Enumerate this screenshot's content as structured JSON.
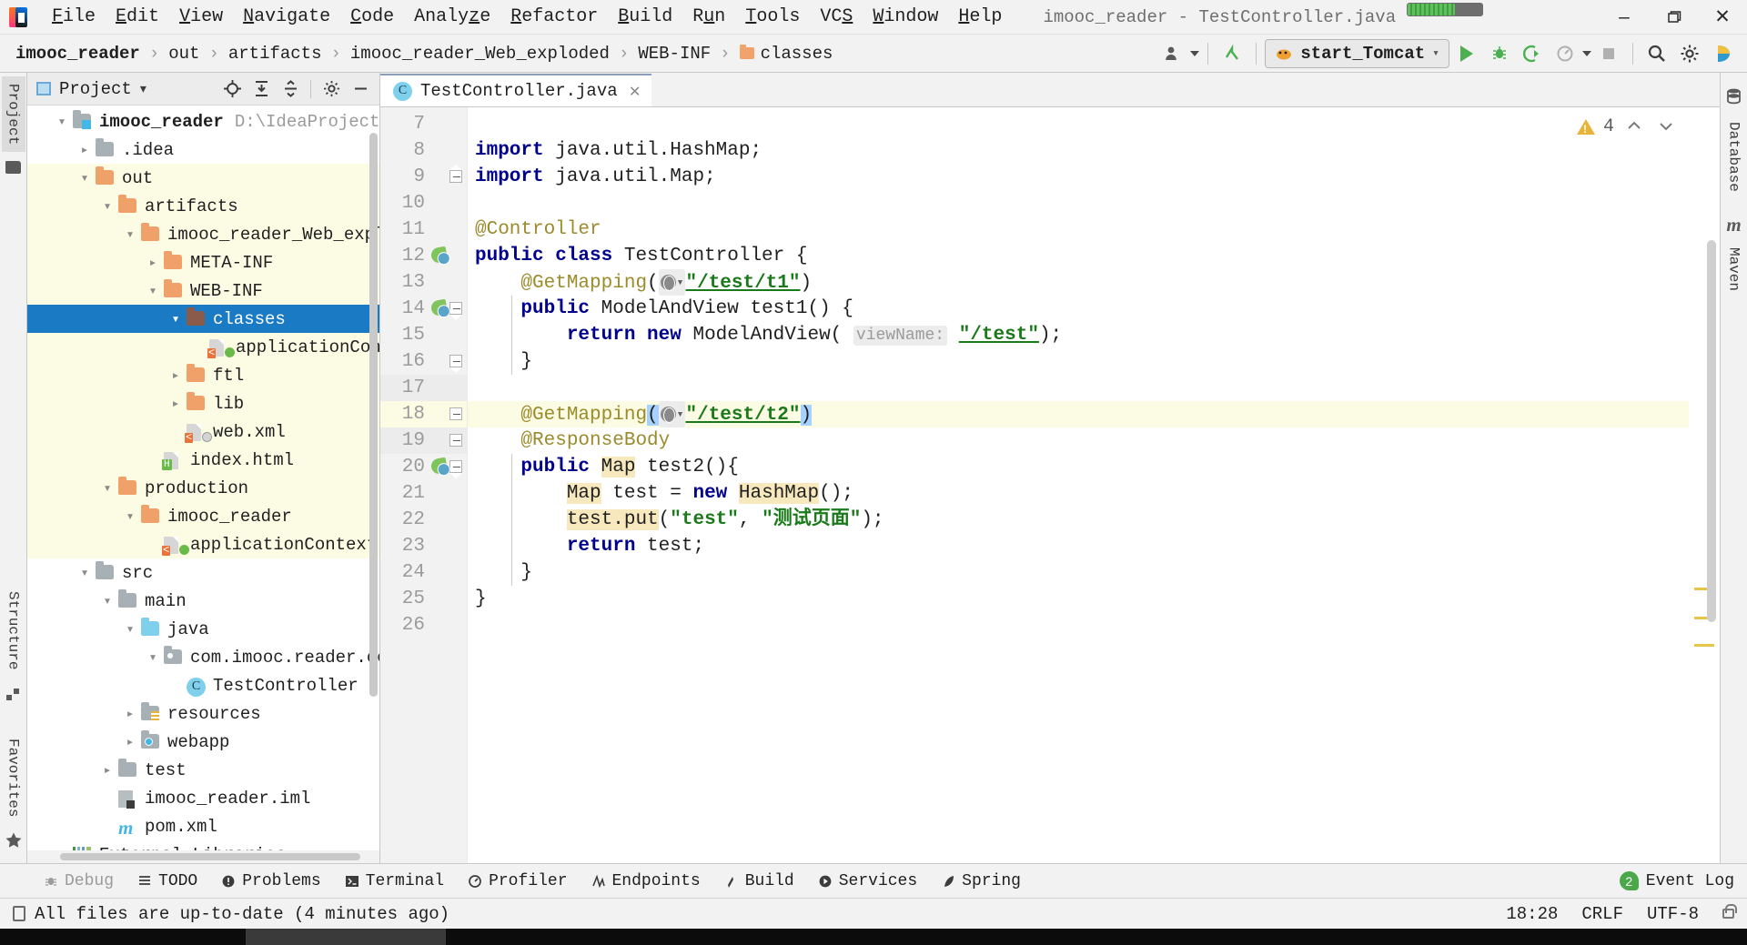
{
  "window": {
    "title": "imooc_reader - TestController.java",
    "minimize_label": "–",
    "maximize_label": "❐",
    "close_label": "✕"
  },
  "menubar": {
    "items": [
      {
        "label": "File",
        "mnemonic": "F"
      },
      {
        "label": "Edit",
        "mnemonic": "E"
      },
      {
        "label": "View",
        "mnemonic": "V"
      },
      {
        "label": "Navigate",
        "mnemonic": "N"
      },
      {
        "label": "Code",
        "mnemonic": "C"
      },
      {
        "label": "Analyze",
        "mnemonic": "z"
      },
      {
        "label": "Refactor",
        "mnemonic": "R"
      },
      {
        "label": "Build",
        "mnemonic": "B"
      },
      {
        "label": "Run",
        "mnemonic": "u"
      },
      {
        "label": "Tools",
        "mnemonic": "T"
      },
      {
        "label": "VCS",
        "mnemonic": "S"
      },
      {
        "label": "Window",
        "mnemonic": "W"
      },
      {
        "label": "Help",
        "mnemonic": "H"
      }
    ]
  },
  "navbar": {
    "breadcrumbs": [
      {
        "label": "imooc_reader",
        "bold": true,
        "icon": null
      },
      {
        "label": "out",
        "bold": false,
        "icon": null
      },
      {
        "label": "artifacts",
        "bold": false,
        "icon": null
      },
      {
        "label": "imooc_reader_Web_exploded",
        "bold": false,
        "icon": null
      },
      {
        "label": "WEB-INF",
        "bold": false,
        "icon": null
      },
      {
        "label": "classes",
        "bold": false,
        "icon": "folder-icon"
      }
    ],
    "separator": "›",
    "run_config": "start_Tomcat",
    "icons": {
      "user": "user-icon",
      "vcs_update": "vcs-update-icon",
      "run": "run-icon",
      "debug": "debug-icon",
      "run_coverage": "run-with-coverage-icon",
      "profiler": "profiler-icon",
      "stop": "stop-icon",
      "search": "search-icon",
      "settings": "gear-icon",
      "ide_assistant": "ide-assistant-icon"
    }
  },
  "left_rail": {
    "tabs": [
      {
        "label": "Project",
        "active": true,
        "icon": "project-icon"
      },
      {
        "label": "Structure",
        "active": false,
        "icon": "structure-icon"
      },
      {
        "label": "Favorites",
        "active": false,
        "icon": "favorites-icon"
      }
    ]
  },
  "right_rail": {
    "tabs": [
      {
        "label": "Database",
        "icon": "database-icon"
      },
      {
        "label": "Maven",
        "icon": "maven-icon"
      }
    ]
  },
  "project_panel": {
    "title": "Project",
    "dropdown": "▾",
    "header_icons": [
      "locate-icon",
      "expand-all-icon",
      "collapse-all-icon",
      "gear-icon",
      "hide-icon"
    ],
    "tree": [
      {
        "label": "imooc_reader",
        "path": "D:\\IdeaProjects\\imooc",
        "depth": 0,
        "arrow": "down",
        "icon": "module-icon",
        "bold": true,
        "tint": false,
        "selected": false
      },
      {
        "label": ".idea",
        "path": "",
        "depth": 1,
        "arrow": "right",
        "icon": "folder-gray-icon",
        "bold": false,
        "tint": false,
        "selected": false
      },
      {
        "label": "out",
        "path": "",
        "depth": 1,
        "arrow": "down",
        "icon": "folder-orange-icon",
        "bold": false,
        "tint": true,
        "selected": false
      },
      {
        "label": "artifacts",
        "path": "",
        "depth": 2,
        "arrow": "down",
        "icon": "folder-orange-icon",
        "bold": false,
        "tint": true,
        "selected": false
      },
      {
        "label": "imooc_reader_Web_exploded",
        "path": "",
        "depth": 3,
        "arrow": "down",
        "icon": "folder-orange-icon",
        "bold": false,
        "tint": true,
        "selected": false
      },
      {
        "label": "META-INF",
        "path": "",
        "depth": 4,
        "arrow": "right",
        "icon": "folder-orange-icon",
        "bold": false,
        "tint": true,
        "selected": false
      },
      {
        "label": "WEB-INF",
        "path": "",
        "depth": 4,
        "arrow": "down",
        "icon": "folder-orange-icon",
        "bold": false,
        "tint": true,
        "selected": false
      },
      {
        "label": "classes",
        "path": "",
        "depth": 5,
        "arrow": "down",
        "icon": "folder-brown-icon",
        "bold": false,
        "tint": true,
        "selected": true
      },
      {
        "label": "applicationContext.",
        "path": "",
        "depth": 6,
        "arrow": "none",
        "icon": "xml-spring-icon",
        "bold": false,
        "tint": true,
        "selected": false
      },
      {
        "label": "ftl",
        "path": "",
        "depth": 5,
        "arrow": "right",
        "icon": "folder-orange-icon",
        "bold": false,
        "tint": true,
        "selected": false
      },
      {
        "label": "lib",
        "path": "",
        "depth": 5,
        "arrow": "right",
        "icon": "folder-orange-icon",
        "bold": false,
        "tint": true,
        "selected": false
      },
      {
        "label": "web.xml",
        "path": "",
        "depth": 5,
        "arrow": "none",
        "icon": "xml-web-icon",
        "bold": false,
        "tint": true,
        "selected": false
      },
      {
        "label": "index.html",
        "path": "",
        "depth": 4,
        "arrow": "none",
        "icon": "html-icon",
        "bold": false,
        "tint": true,
        "selected": false
      },
      {
        "label": "production",
        "path": "",
        "depth": 2,
        "arrow": "down",
        "icon": "folder-orange-icon",
        "bold": false,
        "tint": true,
        "selected": false
      },
      {
        "label": "imooc_reader",
        "path": "",
        "depth": 3,
        "arrow": "down",
        "icon": "folder-orange-icon",
        "bold": false,
        "tint": true,
        "selected": false
      },
      {
        "label": "applicationContext.xml",
        "path": "",
        "depth": 4,
        "arrow": "none",
        "icon": "xml-spring-icon",
        "bold": false,
        "tint": true,
        "selected": false
      },
      {
        "label": "src",
        "path": "",
        "depth": 1,
        "arrow": "down",
        "icon": "folder-gray-icon",
        "bold": false,
        "tint": false,
        "selected": false
      },
      {
        "label": "main",
        "path": "",
        "depth": 2,
        "arrow": "down",
        "icon": "folder-gray-icon",
        "bold": false,
        "tint": false,
        "selected": false
      },
      {
        "label": "java",
        "path": "",
        "depth": 3,
        "arrow": "down",
        "icon": "folder-source-icon",
        "bold": false,
        "tint": false,
        "selected": false
      },
      {
        "label": "com.imooc.reader.control",
        "path": "",
        "depth": 4,
        "arrow": "down",
        "icon": "package-icon",
        "bold": false,
        "tint": false,
        "selected": false
      },
      {
        "label": "TestController",
        "path": "",
        "depth": 5,
        "arrow": "none",
        "icon": "java-class-icon",
        "bold": false,
        "tint": false,
        "selected": false
      },
      {
        "label": "resources",
        "path": "",
        "depth": 3,
        "arrow": "right",
        "icon": "folder-resources-icon",
        "bold": false,
        "tint": false,
        "selected": false
      },
      {
        "label": "webapp",
        "path": "",
        "depth": 3,
        "arrow": "right",
        "icon": "folder-webapp-icon",
        "bold": false,
        "tint": false,
        "selected": false
      },
      {
        "label": "test",
        "path": "",
        "depth": 2,
        "arrow": "right",
        "icon": "folder-gray-icon",
        "bold": false,
        "tint": false,
        "selected": false
      },
      {
        "label": "imooc_reader.iml",
        "path": "",
        "depth": 2,
        "arrow": "none",
        "icon": "iml-icon",
        "bold": false,
        "tint": false,
        "selected": false
      },
      {
        "label": "pom.xml",
        "path": "",
        "depth": 2,
        "arrow": "none",
        "icon": "maven-pom-icon",
        "bold": false,
        "tint": false,
        "selected": false
      },
      {
        "label": "External Libraries",
        "path": "",
        "depth": 0,
        "arrow": "right",
        "icon": "libraries-icon",
        "bold": false,
        "tint": false,
        "selected": false
      }
    ]
  },
  "editor": {
    "tab": {
      "label": "TestController.java",
      "icon": "java-class-icon",
      "close": "✕"
    },
    "inspection": {
      "warning_count": "4",
      "up": "⌃",
      "down": "⌄"
    },
    "first_line_number": 7,
    "lines": [
      {
        "n": "7",
        "state": "blank"
      },
      {
        "n": "8",
        "state": "normal"
      },
      {
        "n": "9",
        "state": "normal"
      },
      {
        "n": "10",
        "state": "blank"
      },
      {
        "n": "11",
        "state": "normal"
      },
      {
        "n": "12",
        "state": "normal"
      },
      {
        "n": "13",
        "state": "normal"
      },
      {
        "n": "14",
        "state": "normal"
      },
      {
        "n": "15",
        "state": "normal"
      },
      {
        "n": "16",
        "state": "normal"
      },
      {
        "n": "17",
        "state": "gray"
      },
      {
        "n": "18",
        "state": "current"
      },
      {
        "n": "19",
        "state": "gray"
      },
      {
        "n": "20",
        "state": "normal"
      },
      {
        "n": "21",
        "state": "normal"
      },
      {
        "n": "22",
        "state": "normal"
      },
      {
        "n": "23",
        "state": "normal"
      },
      {
        "n": "24",
        "state": "normal"
      },
      {
        "n": "25",
        "state": "normal"
      },
      {
        "n": "26",
        "state": "blank"
      }
    ],
    "code_text": {
      "l8": "import java.util.HashMap;",
      "l9": "import java.util.Map;",
      "l11": "@Controller",
      "l12": "public class TestController {",
      "l13": "@GetMapping(\"/test/t1\")",
      "l14": "public ModelAndView test1() {",
      "l15": "return new ModelAndView( viewName: \"/test\");",
      "l16": "}",
      "l18": "@GetMapping(\"/test/t2\")",
      "l19": "@ResponseBody",
      "l20": "public Map test2(){",
      "l21": "Map test = new HashMap();",
      "l22": "test.put(\"test\", \"测试页面\");",
      "l23": "return test;",
      "l24": "}",
      "l25": "}",
      "import_kw": "import",
      "java_hashmap": " java.util.HashMap;",
      "java_map": " java.util.Map;",
      "ann_controller": "@Controller",
      "kw_public": "public",
      "kw_class": "class",
      "cls_testcontroller": " TestController {",
      "ann_getmapping": "@GetMapping",
      "path_t1": "\"/test/t1\"",
      "path_t2": "\"/test/t2\"",
      "sig_test1": " ModelAndView test1() {",
      "kw_return": "return",
      "kw_new": "new",
      "modelandview": " ModelAndView(",
      "hint_viewname": "viewName:",
      "str_test": "\"/test\"",
      "closing_brace": "}",
      "ann_responsebody": "@ResponseBody",
      "type_map": "Map",
      "sig_test2": " test2(){",
      "var_test": " test = ",
      "type_hashmap": "HashMap",
      "parens_semi": "();",
      "test_put": "test.put",
      "str_key_test": "\"test\"",
      "str_cn": "\"测试页面\"",
      "return_test": " test;"
    }
  },
  "toolwindows": {
    "items": [
      {
        "label": "Debug",
        "icon": "debug-icon",
        "dim": true
      },
      {
        "label": "TODO",
        "icon": "todo-icon",
        "dim": false
      },
      {
        "label": "Problems",
        "icon": "problems-icon",
        "dim": false
      },
      {
        "label": "Terminal",
        "icon": "terminal-icon",
        "dim": false
      },
      {
        "label": "Profiler",
        "icon": "profiler-icon",
        "dim": false
      },
      {
        "label": "Endpoints",
        "icon": "endpoints-icon",
        "dim": false
      },
      {
        "label": "Build",
        "icon": "build-icon",
        "dim": false
      },
      {
        "label": "Services",
        "icon": "services-icon",
        "dim": false
      },
      {
        "label": "Spring",
        "icon": "spring-icon",
        "dim": false
      }
    ],
    "event_log": {
      "label": "Event Log",
      "count": "2"
    }
  },
  "statusbar": {
    "message": "All files are up-to-date (4 minutes ago)",
    "time": "18:28",
    "line_separator": "CRLF",
    "encoding": "UTF-8",
    "lock_icon": "unlocked-icon"
  },
  "colors": {
    "selection_blue": "#1a7bc4",
    "tint_yellow": "#fcfbe3",
    "keyword_blue": "#00008f",
    "string_green": "#1a7a1a",
    "annotation_olive": "#9b8b2a",
    "identifier_highlight": "#f7e9bd",
    "warning_yellow": "#e8b339",
    "run_green": "#4caf50"
  }
}
